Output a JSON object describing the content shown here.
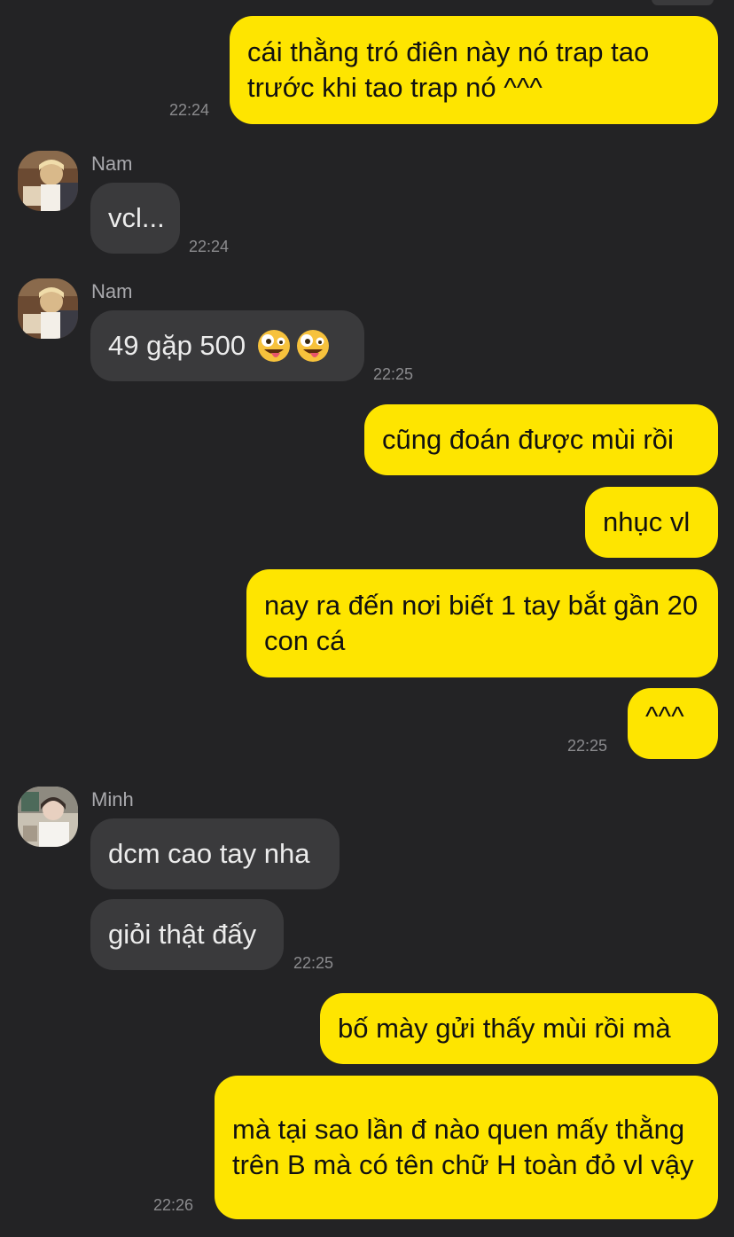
{
  "colors": {
    "background": "#232325",
    "outgoing_bubble": "#fee500",
    "incoming_bubble": "#3a3a3c",
    "timestamp": "#8b8b8e",
    "sender_name": "#a9a9ad"
  },
  "messages": {
    "m1": {
      "text": "cái thằng tró điên này nó trap tao trước khi tao trap nó ^^^",
      "time": "22:24"
    },
    "m2": {
      "sender": "Nam",
      "text": "vcl...",
      "time": "22:24"
    },
    "m3": {
      "sender": "Nam",
      "text": "49 gặp 500",
      "emoji": "zany-face",
      "time": "22:25"
    },
    "m4": {
      "text": "cũng đoán được mùi rồi"
    },
    "m5": {
      "text": "nhục vl"
    },
    "m6": {
      "text": "nay ra đến nơi biết 1 tay bắt gần 20 con cá"
    },
    "m7": {
      "text": "^^^",
      "time": "22:25"
    },
    "m8": {
      "sender": "Minh",
      "text": "dcm cao tay nha"
    },
    "m9": {
      "text": "giỏi thật đấy",
      "time": "22:25"
    },
    "m10": {
      "text": "bố mày gửi thấy mùi rồi mà"
    },
    "m11": {
      "text": "mà tại sao lần đ nào quen mấy thằng trên B mà có tên chữ H toàn đỏ vl vậy",
      "time": "22:26"
    }
  }
}
